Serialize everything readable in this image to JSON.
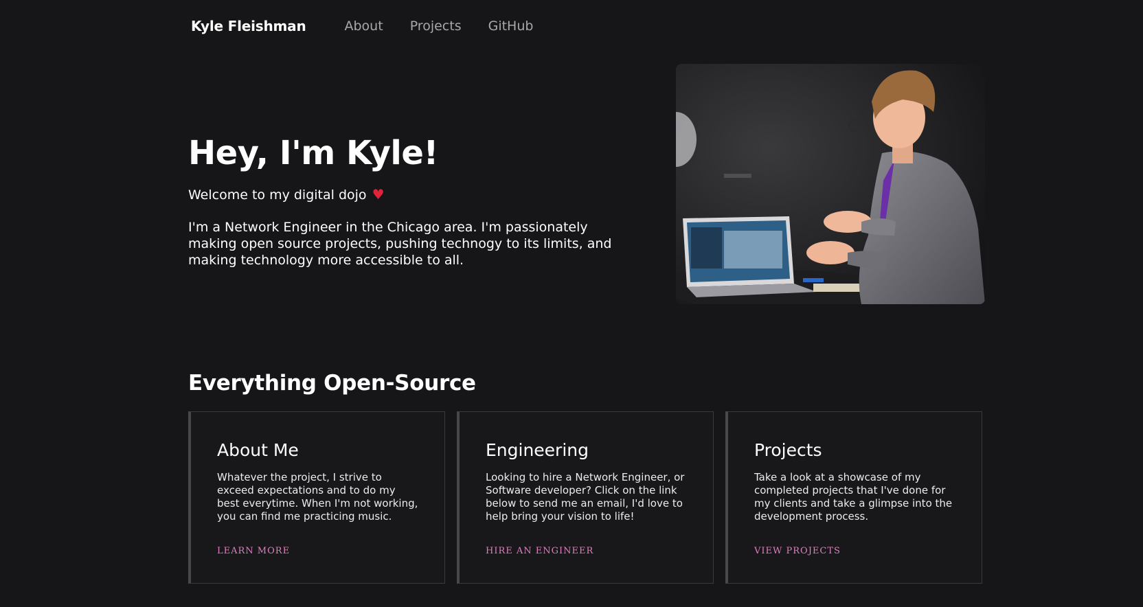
{
  "nav": {
    "brand": "Kyle Fleishman",
    "links": [
      "About",
      "Projects",
      "GitHub"
    ]
  },
  "hero": {
    "title": "Hey, I'm Kyle!",
    "welcome": "Welcome to my digital dojo",
    "description": "I'm a Network Engineer in the Chicago area. I'm passionately making open source projects, pushing technogy to its limits, and making technology more accessible to all.",
    "heart_icon": "heart-icon",
    "photo_icon": "person-with-laptop-photo"
  },
  "section": {
    "title": "Everything Open-Source"
  },
  "cards": [
    {
      "title": "About Me",
      "text": "Whatever the project, I strive to exceed expectations and to do my best everytime. When I'm not working, you can find me practicing music.",
      "link": "LEARN MORE"
    },
    {
      "title": "Engineering",
      "text": "Looking to hire a Network Engineer, or Software developer? Click on the link below to send me an email, I'd love to help bring your vision to life!",
      "link": "HIRE AN ENGINEER"
    },
    {
      "title": "Projects",
      "text": "Take a look at a showcase of my completed projects that I've done for my clients and take a glimpse into the development process.",
      "link": "VIEW PROJECTS"
    }
  ],
  "colors": {
    "background": "#161618",
    "accent_link": "#e07fbf",
    "heart": "#e0233a",
    "nav_link": "#a8a8aa"
  }
}
